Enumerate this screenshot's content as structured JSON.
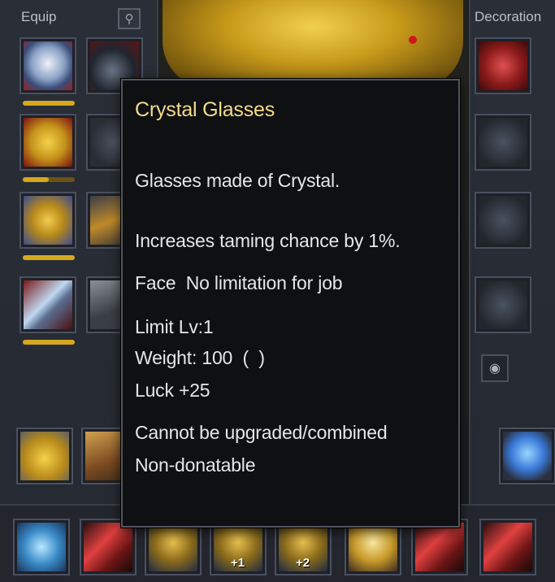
{
  "panels": {
    "equip_label": "Equip",
    "decoration_label": "Decoration"
  },
  "icons": {
    "corner_button": "magnify-wand-icon",
    "eye_button": "eye-icon"
  },
  "tooltip": {
    "title": "Crystal Glasses",
    "description": "Glasses made of Crystal.",
    "effect": "Increases taming chance by 1%.",
    "slot_line": "Face  No limitation for job",
    "limit_level": "Limit Lv:1",
    "weight": "Weight: 100  (  )",
    "stat": "Luck +25",
    "upgrade_note": "Cannot be upgraded/combined",
    "donate_note": "Non-donatable"
  },
  "durability": {
    "helm": 1.0,
    "chest": 0.5,
    "glove": 1.0,
    "sword": 1.0
  },
  "hotbar": {
    "refine_labels": [
      "+1",
      "+2"
    ]
  },
  "colors": {
    "title": "#f3dc8a",
    "text": "#e4e6ea",
    "tooltip_bg": "#0f1012",
    "durability": "#d6a81e"
  }
}
